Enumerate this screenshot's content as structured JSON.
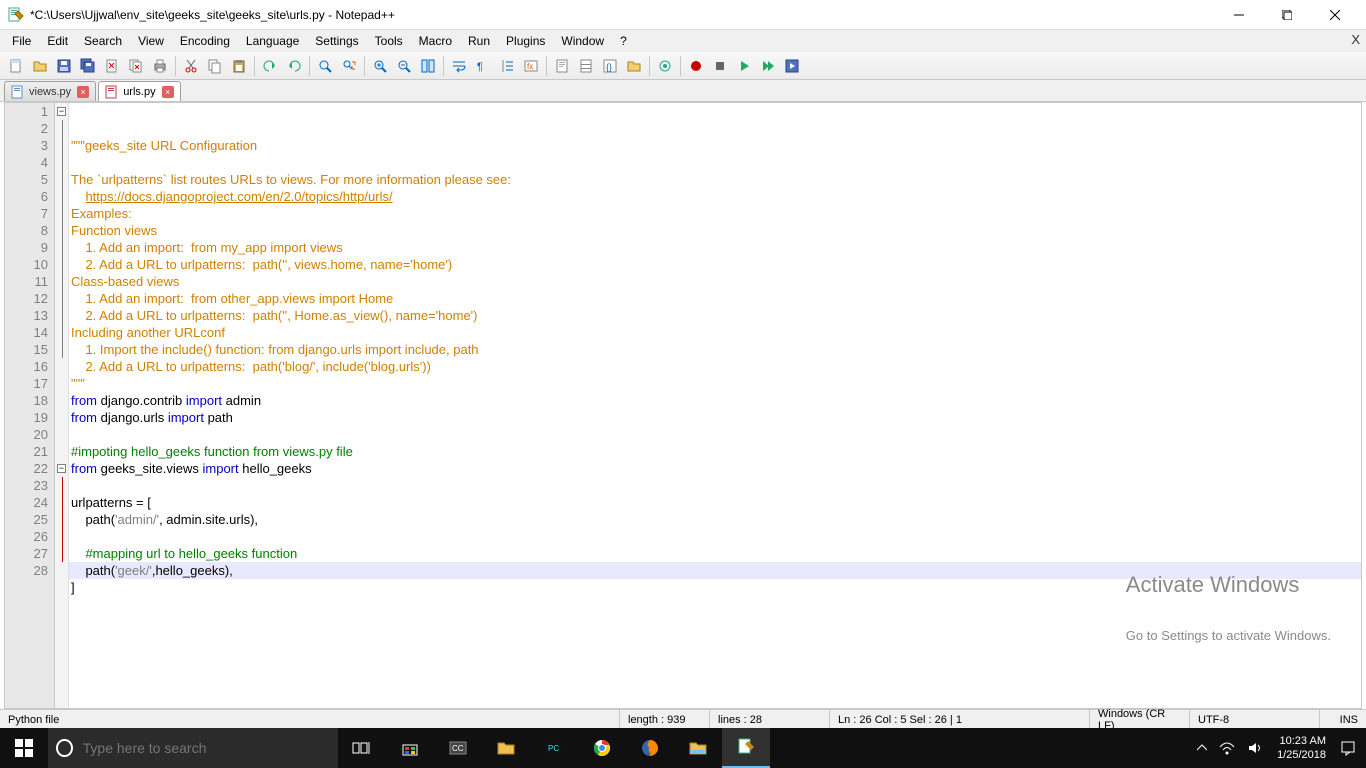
{
  "window": {
    "title": "*C:\\Users\\Ujjwal\\env_site\\geeks_site\\geeks_site\\urls.py - Notepad++"
  },
  "menu": [
    "File",
    "Edit",
    "Search",
    "View",
    "Encoding",
    "Language",
    "Settings",
    "Tools",
    "Macro",
    "Run",
    "Plugins",
    "Window",
    "?"
  ],
  "tabs": [
    {
      "name": "views.py",
      "active": false
    },
    {
      "name": "urls.py",
      "active": true
    }
  ],
  "editor": {
    "total_lines": 28,
    "highlight_line": 26,
    "lines": [
      {
        "n": 1,
        "seg": [
          {
            "c": "s-doc",
            "t": "\"\"\"geeks_site URL Configuration"
          }
        ]
      },
      {
        "n": 2,
        "seg": [
          {
            "c": "s-doc",
            "t": ""
          }
        ]
      },
      {
        "n": 3,
        "seg": [
          {
            "c": "s-doc",
            "t": "The `urlpatterns` list routes URLs to views. For more information please see:"
          }
        ]
      },
      {
        "n": 4,
        "seg": [
          {
            "c": "s-doc",
            "t": "    "
          },
          {
            "c": "s-link",
            "t": "https://docs.djangoproject.com/en/2.0/topics/http/urls/"
          }
        ]
      },
      {
        "n": 5,
        "seg": [
          {
            "c": "s-doc",
            "t": "Examples:"
          }
        ]
      },
      {
        "n": 6,
        "seg": [
          {
            "c": "s-doc",
            "t": "Function views"
          }
        ]
      },
      {
        "n": 7,
        "seg": [
          {
            "c": "s-doc",
            "t": "    1. Add an import:  from my_app import views"
          }
        ]
      },
      {
        "n": 8,
        "seg": [
          {
            "c": "s-doc",
            "t": "    2. Add a URL to urlpatterns:  path('', views.home, name='home')"
          }
        ]
      },
      {
        "n": 9,
        "seg": [
          {
            "c": "s-doc",
            "t": "Class-based views"
          }
        ]
      },
      {
        "n": 10,
        "seg": [
          {
            "c": "s-doc",
            "t": "    1. Add an import:  from other_app.views import Home"
          }
        ]
      },
      {
        "n": 11,
        "seg": [
          {
            "c": "s-doc",
            "t": "    2. Add a URL to urlpatterns:  path('', Home.as_view(), name='home')"
          }
        ]
      },
      {
        "n": 12,
        "seg": [
          {
            "c": "s-doc",
            "t": "Including another URLconf"
          }
        ]
      },
      {
        "n": 13,
        "seg": [
          {
            "c": "s-doc",
            "t": "    1. Import the include() function: from django.urls import include, path"
          }
        ]
      },
      {
        "n": 14,
        "seg": [
          {
            "c": "s-doc",
            "t": "    2. Add a URL to urlpatterns:  path('blog/', include('blog.urls'))"
          }
        ]
      },
      {
        "n": 15,
        "seg": [
          {
            "c": "s-doc",
            "t": "\"\"\""
          }
        ]
      },
      {
        "n": 16,
        "seg": [
          {
            "c": "s-kw",
            "t": "from"
          },
          {
            "c": "s-plain",
            "t": " django.contrib "
          },
          {
            "c": "s-kw",
            "t": "import"
          },
          {
            "c": "s-plain",
            "t": " admin"
          }
        ]
      },
      {
        "n": 17,
        "seg": [
          {
            "c": "s-kw",
            "t": "from"
          },
          {
            "c": "s-plain",
            "t": " django.urls "
          },
          {
            "c": "s-kw",
            "t": "import"
          },
          {
            "c": "s-plain",
            "t": " path"
          }
        ]
      },
      {
        "n": 18,
        "seg": []
      },
      {
        "n": 19,
        "seg": [
          {
            "c": "s-cmt",
            "t": "#impoting hello_geeks function from views.py file"
          }
        ]
      },
      {
        "n": 20,
        "seg": [
          {
            "c": "s-kw",
            "t": "from"
          },
          {
            "c": "s-plain",
            "t": " geeks_site.views "
          },
          {
            "c": "s-kw",
            "t": "import"
          },
          {
            "c": "s-plain",
            "t": " hello_geeks"
          }
        ]
      },
      {
        "n": 21,
        "seg": []
      },
      {
        "n": 22,
        "seg": [
          {
            "c": "s-plain",
            "t": "urlpatterns = ["
          }
        ]
      },
      {
        "n": 23,
        "seg": [
          {
            "c": "s-plain",
            "t": "    path("
          },
          {
            "c": "s-str",
            "t": "'admin/'"
          },
          {
            "c": "s-plain",
            "t": ", admin.site.urls),"
          }
        ]
      },
      {
        "n": 24,
        "seg": []
      },
      {
        "n": 25,
        "seg": [
          {
            "c": "s-plain",
            "t": "    "
          },
          {
            "c": "s-cmt",
            "t": "#mapping url to hello_geeks function"
          }
        ]
      },
      {
        "n": 26,
        "seg": [
          {
            "c": "s-plain",
            "t": "    path("
          },
          {
            "c": "s-str",
            "t": "'geek/'"
          },
          {
            "c": "s-plain",
            "t": ",hello_geeks),"
          }
        ]
      },
      {
        "n": 27,
        "seg": [
          {
            "c": "s-plain",
            "t": "]"
          }
        ]
      },
      {
        "n": 28,
        "seg": []
      }
    ]
  },
  "status": {
    "filetype": "Python file",
    "length": "length : 939",
    "lines": "lines : 28",
    "pos": "Ln : 26   Col : 5   Sel : 26 | 1",
    "eol": "Windows (CR LF)",
    "encoding": "UTF-8",
    "mode": "INS"
  },
  "watermark": {
    "l1": "Activate Windows",
    "l2": "Go to Settings to activate Windows."
  },
  "taskbar": {
    "search_placeholder": "Type here to search",
    "time": "10:23 AM",
    "date": "1/25/2018"
  }
}
